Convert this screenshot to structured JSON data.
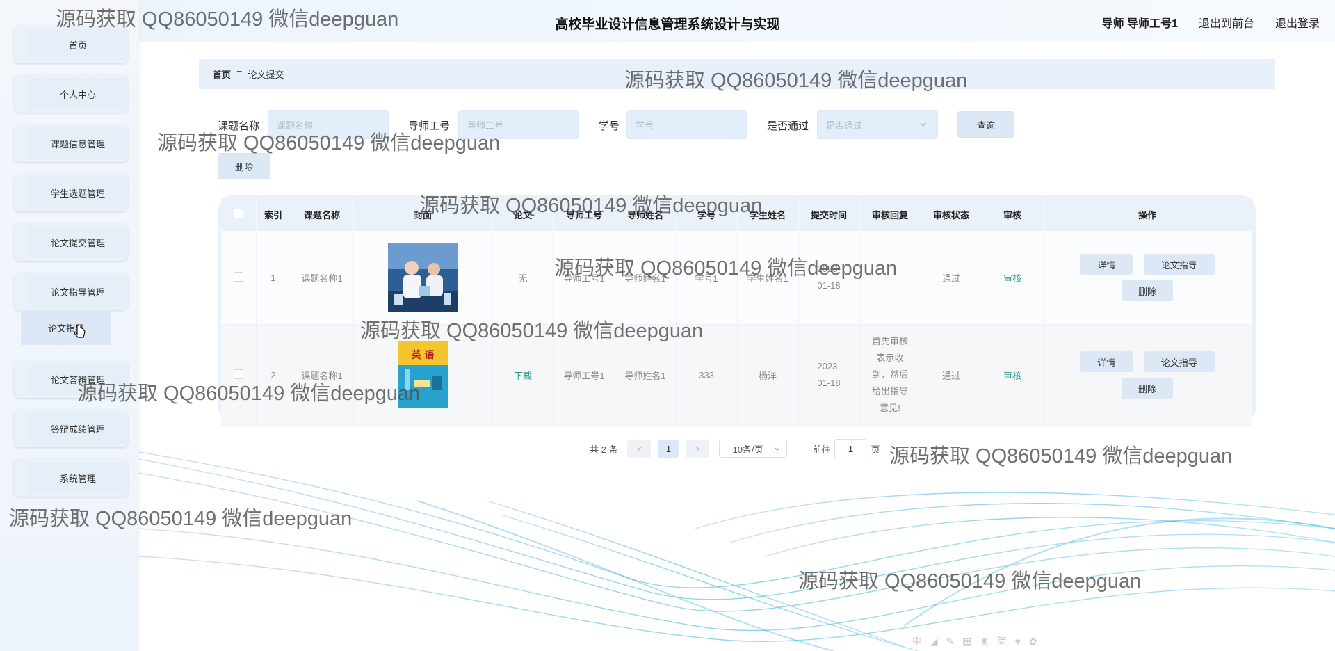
{
  "header": {
    "title": "高校毕业设计信息管理系统设计与实现",
    "user_label": "导师 导师工号1",
    "back_front": "退出到前台",
    "logout": "退出登录"
  },
  "sidebar": {
    "items": [
      {
        "label": "首页"
      },
      {
        "label": "个人中心"
      },
      {
        "label": "课题信息管理"
      },
      {
        "label": "学生选题管理"
      },
      {
        "label": "论文提交管理"
      },
      {
        "label": "论文指导管理"
      },
      {
        "label": "论文答辩管理"
      },
      {
        "label": "答辩成绩管理"
      },
      {
        "label": "系统管理"
      }
    ],
    "submenu": {
      "label": "论文指导"
    }
  },
  "breadcrumb": {
    "home": "首页",
    "sep": "Ξ",
    "current": "论文提交"
  },
  "search": {
    "course_label": "课题名称",
    "course_ph": "课题名称",
    "teacher_label": "导师工号",
    "teacher_ph": "导师工号",
    "student_label": "学号",
    "student_ph": "学号",
    "pass_label": "是否通过",
    "pass_ph": "是否通过",
    "query_btn": "查询",
    "delete_btn": "删除"
  },
  "table": {
    "headers": [
      "",
      "索引",
      "课题名称",
      "封面",
      "论文",
      "导师工号",
      "导师姓名",
      "学号",
      "学生姓名",
      "提交时间",
      "审核回复",
      "审核状态",
      "审核",
      "操作"
    ],
    "rows": [
      {
        "index": "1",
        "course": "课题名称1",
        "paper": "无",
        "teacher_id": "导师工号1",
        "teacher_name": "导师姓名1",
        "student_id": "学号1",
        "student_name": "学生姓名1",
        "time": "2023-01-18",
        "reply": "",
        "status": "通过",
        "audit": "审核",
        "btn_detail": "详情",
        "btn_guide": "论文指导",
        "btn_delete": "删除"
      },
      {
        "index": "2",
        "course": "课题名称1",
        "paper": "下载",
        "teacher_id": "导师工号1",
        "teacher_name": "导师姓名1",
        "student_id": "333",
        "student_name": "杨洋",
        "time": "2023-01-18",
        "reply": "首先审核表示收到，然后给出指导意见!",
        "status": "通过",
        "audit": "审核",
        "btn_detail": "详情",
        "btn_guide": "论文指导",
        "btn_delete": "删除",
        "cover_text": "英 语"
      }
    ]
  },
  "pagination": {
    "total": "共 2 条",
    "prev": "<",
    "page": "1",
    "next": ">",
    "size": "10条/页",
    "goto": "前往",
    "goto_value": "1",
    "page_suffix": "页"
  },
  "watermark": "源码获取 QQ86050149 微信deepguan",
  "bottom_tools": "中 ◢ ✎ ▦ ♜ 简 ♥ ✿"
}
